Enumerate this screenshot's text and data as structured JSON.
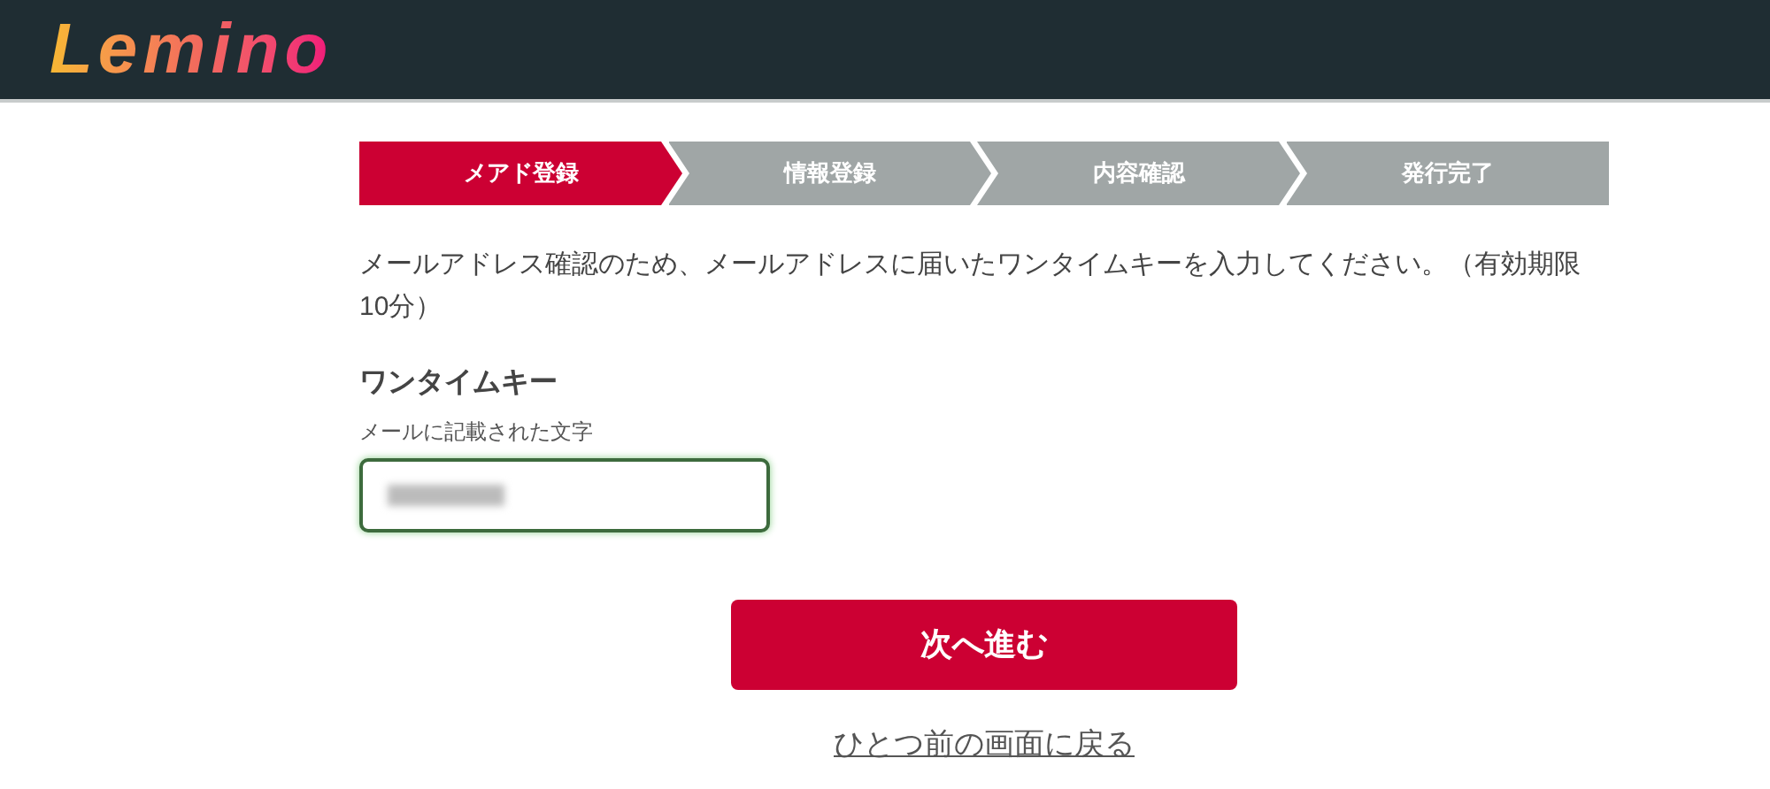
{
  "header": {
    "logo": "Lemino"
  },
  "steps": [
    {
      "label": "メアド登録",
      "selected": true
    },
    {
      "label": "情報登録",
      "selected": false
    },
    {
      "label": "内容確認",
      "selected": false
    },
    {
      "label": "発行完了",
      "selected": false
    }
  ],
  "instructions": "メールアドレス確認のため、メールアドレスに届いたワンタイムキーを入力してください。（有効期限10分）",
  "field": {
    "label": "ワンタイムキー",
    "hint": "メールに記載された文字",
    "focused": true,
    "value_blurred": true
  },
  "next_button": "次へ進む",
  "back_link": "ひとつ前の画面に戻る"
}
